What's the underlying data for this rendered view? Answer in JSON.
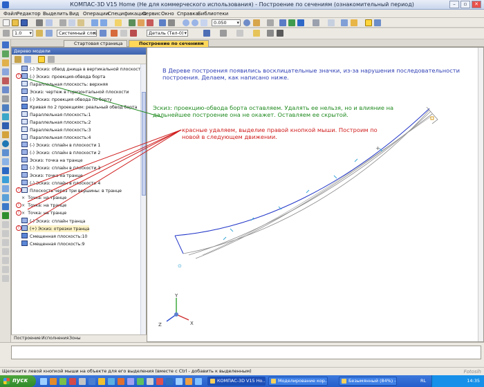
{
  "window": {
    "title": "КОМПАС-3D V15 Home (Не для коммерческого использования) - Построение по сечениям (ознакомительный период)",
    "min": "–",
    "max": "▫",
    "close": "✕"
  },
  "menu": [
    "Файл",
    "Редактор",
    "Выделить",
    "Вид",
    "Операции",
    "Спецификация",
    "Сервис",
    "Окно",
    "Справка",
    "Библиотеки"
  ],
  "toolbar2": {
    "line_width": "1.0",
    "layer": "Системный слой (0)",
    "detail": "Деталь (Тел-0)"
  },
  "toolbar1": {
    "zoom": "0.050"
  },
  "tabs": {
    "start": "Стартовая страница",
    "build": "Построение по сечениям"
  },
  "tree": {
    "header": "Дерево модели",
    "items": [
      "(-) Эскиз: обвод днища в вертикальной плоскости",
      "(-) Эскиз: проекция-обвода борта",
      "Параллельная плоскость: верхняя",
      "Эскиз: чертеж в горизонтальной плоскости",
      "(-) Эскиз: проекция обвода по борту",
      "Кривая по 2 проекциям: реальный обвод борта",
      "Параллельная плоскость:1",
      "Параллельная плоскость:2",
      "Параллельная плоскость:3",
      "Параллельная плоскость:4",
      "(-) Эскиз: сплайн в плоскости 1",
      "(-) Эскиз: сплайн в плоскости 2",
      "Эскиз: точка на транце",
      "(-) Эскиз: сплайн в плоскости 3",
      "Эскиз: точка на транце",
      "(-) Эскиз: сплайн в плоскости 4",
      "Плоскость через три вершины: в транце",
      "Точка: на транце",
      "Точка: на транце",
      "Точка: на транце",
      "(-) Эскиз: сплайн транца",
      "(+) Эскиз: отрезки транца",
      "Смещенная плоскость:10",
      "Смещенная плоскость:9"
    ],
    "bottom_tabs": [
      "Построение",
      "Исполнения",
      "Зоны"
    ]
  },
  "notes": {
    "blue": "В Дереве построения появились восклицательные значки, из-за нарушения последовательности построения. Делаем, как написано ниже.",
    "green": "Эскиз: проекцию-обвода борта оставляем. Удалять ее нельзя, но и влияние на дальнейшее построение она не окажет. Оставляем ее скрытой.",
    "red": "красные удаляем, выделие правой кнопкой мыши. Построим по новой в следующем движении."
  },
  "axes": {
    "x": "X",
    "y": "Y",
    "z": "Z"
  },
  "status": "Щелкните левой кнопкой мыши на объекте для его выделения (вместе с Ctrl - добавить к выделенным)",
  "taskbar": {
    "start": "пуск",
    "tasks": [
      "КОМПАС-3D V15 Ho...",
      "Моделирование кор...",
      "Безымянный (84%) - ..."
    ],
    "lang": "RL",
    "clock": "14:35"
  },
  "watermark": "Fotosih",
  "colors": {
    "blue_note": "#2f3fb4",
    "green_note": "#1f8a1f",
    "red_note": "#d01c1c",
    "active_tab": "#ffd85a"
  }
}
